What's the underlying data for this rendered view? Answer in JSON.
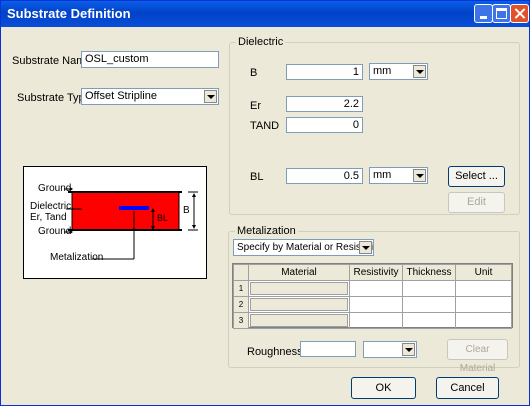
{
  "window": {
    "title": "Substrate Definition"
  },
  "substrate": {
    "name_label": "Substrate Name:",
    "name_value": "OSL_custom",
    "type_label": "Substrate Type:",
    "type_value": "Offset Stripline"
  },
  "diagram": {
    "ground_top": "Ground",
    "dielectric_line1": "Dielectric,",
    "dielectric_line2": "Er, Tand",
    "ground_bottom": "Ground",
    "metalization": "Metalization",
    "bl_label": "BL",
    "b_label": "B",
    "colors": {
      "dielectric": "#ff0000",
      "strip": "#0000ff"
    }
  },
  "dielectric": {
    "legend": "Dielectric",
    "b_label": "B",
    "b_value": "1",
    "b_unit": "mm",
    "er_label": "Er",
    "er_value": "2.2",
    "tand_label": "TAND",
    "tand_value": "0",
    "bl_label": "BL",
    "bl_value": "0.5",
    "bl_unit": "mm",
    "select_button": "Select ...",
    "edit_button": "Edit"
  },
  "metalization": {
    "legend": "Metalization",
    "mode_value": "Specify by Material or Resistivity",
    "columns": [
      "Material",
      "Resistivity",
      "Thickness",
      "Unit"
    ],
    "rows": [
      "1",
      "2",
      "3"
    ],
    "roughness_label": "Roughness:",
    "roughness_value": "",
    "roughness_unit": "",
    "clear_button": "Clear Material"
  },
  "footer": {
    "ok_button": "OK",
    "cancel_button": "Cancel"
  }
}
